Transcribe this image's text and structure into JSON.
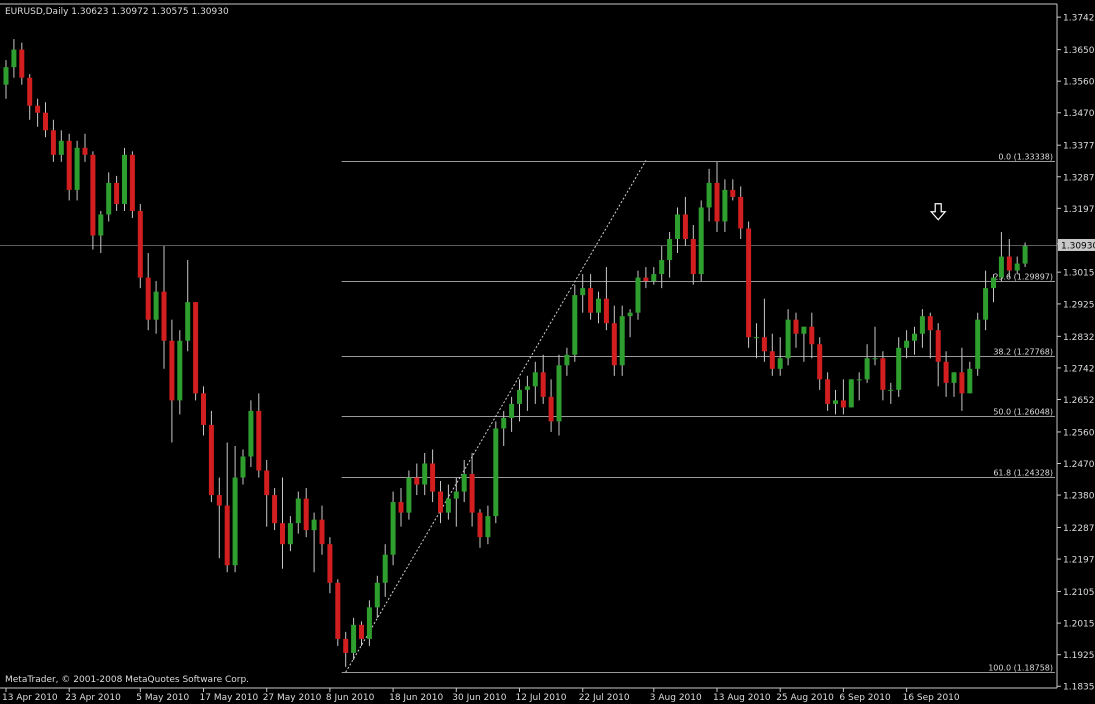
{
  "window": {
    "header": "EURUSD,Daily  1.30623 1.30972 1.30575 1.30930",
    "footer": "MetaTrader, © 2001-2008 MetaQuotes Software Corp."
  },
  "colors": {
    "background": "#000000",
    "frame": "#c8c8c8",
    "text": "#dcdcdc",
    "bull": "#2e9e2e",
    "bear": "#d21e1e",
    "wick": "#c8c8c8",
    "fib": "#9a9a9a",
    "price_tag_bg": "#c8c8c8",
    "price_tag_text": "#000000"
  },
  "chart_data": {
    "type": "candlestick",
    "symbol": "EURUSD",
    "timeframe": "Daily",
    "ohlc_header": {
      "open": 1.30623,
      "high": 1.30972,
      "low": 1.30575,
      "close": 1.3093
    },
    "current_price": 1.3093,
    "current_price_label": "1.30930",
    "ylim": [
      1.183,
      1.378
    ],
    "y_ticks": [
      "1.37425",
      "1.36500",
      "1.35600",
      "1.34700",
      "1.33775",
      "1.32875",
      "1.31975",
      "1.30965",
      "1.30155",
      "1.29250",
      "1.28325",
      "1.27425",
      "1.26525",
      "1.25600",
      "1.24700",
      "1.23800",
      "1.22875",
      "1.21975",
      "1.21050",
      "1.20150",
      "1.19250",
      "1.18350"
    ],
    "x_ticks": [
      {
        "label": "13 Apr 2010",
        "index": 0
      },
      {
        "label": "23 Apr 2010",
        "index": 8
      },
      {
        "label": "5 May 2010",
        "index": 17
      },
      {
        "label": "17 May 2010",
        "index": 25
      },
      {
        "label": "27 May 2010",
        "index": 33
      },
      {
        "label": "8 Jun 2010",
        "index": 41
      },
      {
        "label": "18 Jun 2010",
        "index": 49
      },
      {
        "label": "30 Jun 2010",
        "index": 57
      },
      {
        "label": "12 Jul 2010",
        "index": 65
      },
      {
        "label": "22 Jul 2010",
        "index": 73
      },
      {
        "label": "3 Aug 2010",
        "index": 82
      },
      {
        "label": "13 Aug 2010",
        "index": 90
      },
      {
        "label": "25 Aug 2010",
        "index": 98
      },
      {
        "label": "6 Sep 2010",
        "index": 106
      },
      {
        "label": "16 Sep 2010",
        "index": 114
      }
    ],
    "candles": [
      [
        1.355,
        1.362,
        1.351,
        1.36
      ],
      [
        1.36,
        1.368,
        1.357,
        1.365
      ],
      [
        1.365,
        1.367,
        1.355,
        1.357
      ],
      [
        1.357,
        1.358,
        1.345,
        1.349
      ],
      [
        1.349,
        1.351,
        1.343,
        1.347
      ],
      [
        1.347,
        1.35,
        1.34,
        1.342
      ],
      [
        1.342,
        1.345,
        1.333,
        1.335
      ],
      [
        1.335,
        1.342,
        1.333,
        1.339
      ],
      [
        1.339,
        1.341,
        1.322,
        1.325
      ],
      [
        1.325,
        1.339,
        1.322,
        1.337
      ],
      [
        1.337,
        1.341,
        1.333,
        1.335
      ],
      [
        1.335,
        1.336,
        1.308,
        1.312
      ],
      [
        1.312,
        1.319,
        1.307,
        1.318
      ],
      [
        1.318,
        1.33,
        1.316,
        1.327
      ],
      [
        1.327,
        1.329,
        1.319,
        1.321
      ],
      [
        1.321,
        1.337,
        1.319,
        1.335
      ],
      [
        1.335,
        1.336,
        1.317,
        1.319
      ],
      [
        1.319,
        1.321,
        1.297,
        1.3
      ],
      [
        1.3,
        1.307,
        1.285,
        1.288
      ],
      [
        1.288,
        1.299,
        1.284,
        1.296
      ],
      [
        1.296,
        1.309,
        1.274,
        1.282
      ],
      [
        1.282,
        1.288,
        1.253,
        1.265
      ],
      [
        1.265,
        1.285,
        1.261,
        1.282
      ],
      [
        1.282,
        1.305,
        1.279,
        1.293
      ],
      [
        1.293,
        1.293,
        1.265,
        1.267
      ],
      [
        1.267,
        1.269,
        1.255,
        1.258
      ],
      [
        1.258,
        1.262,
        1.236,
        1.238
      ],
      [
        1.238,
        1.243,
        1.22,
        1.235
      ],
      [
        1.235,
        1.253,
        1.216,
        1.218
      ],
      [
        1.218,
        1.252,
        1.216,
        1.243
      ],
      [
        1.243,
        1.251,
        1.241,
        1.249
      ],
      [
        1.249,
        1.265,
        1.246,
        1.262
      ],
      [
        1.262,
        1.267,
        1.243,
        1.245
      ],
      [
        1.245,
        1.248,
        1.229,
        1.238
      ],
      [
        1.238,
        1.24,
        1.228,
        1.23
      ],
      [
        1.23,
        1.243,
        1.217,
        1.224
      ],
      [
        1.224,
        1.232,
        1.222,
        1.23
      ],
      [
        1.23,
        1.239,
        1.227,
        1.237
      ],
      [
        1.237,
        1.24,
        1.226,
        1.228
      ],
      [
        1.228,
        1.233,
        1.216,
        1.231
      ],
      [
        1.231,
        1.235,
        1.221,
        1.224
      ],
      [
        1.224,
        1.226,
        1.21,
        1.213
      ],
      [
        1.213,
        1.214,
        1.195,
        1.197
      ],
      [
        1.197,
        1.199,
        1.189,
        1.193
      ],
      [
        1.193,
        1.203,
        1.191,
        1.201
      ],
      [
        1.201,
        1.202,
        1.195,
        1.197
      ],
      [
        1.197,
        1.208,
        1.195,
        1.206
      ],
      [
        1.206,
        1.215,
        1.203,
        1.213
      ],
      [
        1.213,
        1.224,
        1.209,
        1.221
      ],
      [
        1.221,
        1.239,
        1.218,
        1.236
      ],
      [
        1.236,
        1.24,
        1.229,
        1.233
      ],
      [
        1.233,
        1.245,
        1.231,
        1.243
      ],
      [
        1.243,
        1.247,
        1.238,
        1.241
      ],
      [
        1.241,
        1.25,
        1.238,
        1.247
      ],
      [
        1.247,
        1.251,
        1.236,
        1.239
      ],
      [
        1.239,
        1.242,
        1.23,
        1.233
      ],
      [
        1.233,
        1.241,
        1.231,
        1.237
      ],
      [
        1.237,
        1.243,
        1.229,
        1.239
      ],
      [
        1.239,
        1.248,
        1.236,
        1.244
      ],
      [
        1.244,
        1.25,
        1.229,
        1.233
      ],
      [
        1.233,
        1.234,
        1.223,
        1.226
      ],
      [
        1.226,
        1.235,
        1.224,
        1.232
      ],
      [
        1.232,
        1.259,
        1.23,
        1.257
      ],
      [
        1.257,
        1.262,
        1.252,
        1.26
      ],
      [
        1.26,
        1.266,
        1.256,
        1.264
      ],
      [
        1.264,
        1.271,
        1.259,
        1.268
      ],
      [
        1.268,
        1.272,
        1.262,
        1.269
      ],
      [
        1.269,
        1.276,
        1.264,
        1.273
      ],
      [
        1.273,
        1.278,
        1.264,
        1.266
      ],
      [
        1.266,
        1.271,
        1.256,
        1.259
      ],
      [
        1.259,
        1.278,
        1.255,
        1.275
      ],
      [
        1.275,
        1.28,
        1.272,
        1.278
      ],
      [
        1.278,
        1.298,
        1.276,
        1.295
      ],
      [
        1.295,
        1.301,
        1.29,
        1.297
      ],
      [
        1.297,
        1.301,
        1.288,
        1.29
      ],
      [
        1.29,
        1.296,
        1.287,
        1.294
      ],
      [
        1.294,
        1.303,
        1.285,
        1.287
      ],
      [
        1.287,
        1.292,
        1.272,
        1.275
      ],
      [
        1.275,
        1.292,
        1.272,
        1.289
      ],
      [
        1.289,
        1.291,
        1.283,
        1.29
      ],
      [
        1.29,
        1.302,
        1.288,
        1.3
      ],
      [
        1.3,
        1.303,
        1.297,
        1.299
      ],
      [
        1.299,
        1.303,
        1.298,
        1.301
      ],
      [
        1.301,
        1.309,
        1.297,
        1.305
      ],
      [
        1.305,
        1.313,
        1.3,
        1.311
      ],
      [
        1.311,
        1.32,
        1.307,
        1.318
      ],
      [
        1.318,
        1.323,
        1.309,
        1.311
      ],
      [
        1.311,
        1.315,
        1.298,
        1.301
      ],
      [
        1.301,
        1.322,
        1.299,
        1.32
      ],
      [
        1.32,
        1.331,
        1.316,
        1.327
      ],
      [
        1.327,
        1.333,
        1.313,
        1.316
      ],
      [
        1.316,
        1.328,
        1.313,
        1.325
      ],
      [
        1.325,
        1.328,
        1.322,
        1.323
      ],
      [
        1.323,
        1.326,
        1.311,
        1.314
      ],
      [
        1.314,
        1.316,
        1.28,
        1.283
      ],
      [
        1.283,
        1.287,
        1.277,
        1.283
      ],
      [
        1.283,
        1.294,
        1.276,
        1.279
      ],
      [
        1.279,
        1.284,
        1.272,
        1.274
      ],
      [
        1.274,
        1.283,
        1.272,
        1.277
      ],
      [
        1.277,
        1.291,
        1.275,
        1.288
      ],
      [
        1.288,
        1.29,
        1.28,
        1.284
      ],
      [
        1.284,
        1.286,
        1.276,
        1.286
      ],
      [
        1.286,
        1.29,
        1.277,
        1.281
      ],
      [
        1.281,
        1.283,
        1.268,
        1.271
      ],
      [
        1.271,
        1.273,
        1.262,
        1.264
      ],
      [
        1.264,
        1.268,
        1.261,
        1.265
      ],
      [
        1.265,
        1.271,
        1.261,
        1.263
      ],
      [
        1.263,
        1.271,
        1.263,
        1.271
      ],
      [
        1.271,
        1.273,
        1.265,
        1.271
      ],
      [
        1.271,
        1.281,
        1.27,
        1.277
      ],
      [
        1.277,
        1.286,
        1.275,
        1.277
      ],
      [
        1.277,
        1.279,
        1.265,
        1.268
      ],
      [
        1.268,
        1.27,
        1.264,
        1.268
      ],
      [
        1.268,
        1.283,
        1.266,
        1.28
      ],
      [
        1.28,
        1.285,
        1.277,
        1.282
      ],
      [
        1.282,
        1.286,
        1.278,
        1.284
      ],
      [
        1.284,
        1.291,
        1.28,
        1.289
      ],
      [
        1.289,
        1.29,
        1.277,
        1.285
      ],
      [
        1.285,
        1.287,
        1.269,
        1.276
      ],
      [
        1.276,
        1.279,
        1.266,
        1.27
      ],
      [
        1.27,
        1.273,
        1.266,
        1.273
      ],
      [
        1.273,
        1.28,
        1.262,
        1.267
      ],
      [
        1.267,
        1.276,
        1.267,
        1.274
      ],
      [
        1.274,
        1.29,
        1.272,
        1.288
      ],
      [
        1.288,
        1.302,
        1.285,
        1.297
      ],
      [
        1.297,
        1.301,
        1.293,
        1.3
      ],
      [
        1.3,
        1.313,
        1.299,
        1.306
      ],
      [
        1.306,
        1.311,
        1.3,
        1.302
      ],
      [
        1.302,
        1.306,
        1.301,
        1.304
      ],
      [
        1.304,
        1.31,
        1.303,
        1.309
      ]
    ],
    "fibonacci": {
      "start_index": 43,
      "end_index": 81,
      "levels": [
        {
          "label": "0.0 (1.33338)",
          "price": 1.33338
        },
        {
          "label": "23.6 (1.29897)",
          "price": 1.29897
        },
        {
          "label": "38.2 (1.27768)",
          "price": 1.27768
        },
        {
          "label": "50.0 (1.26048)",
          "price": 1.26048
        },
        {
          "label": "61.8 (1.24328)",
          "price": 1.24328
        },
        {
          "label": "100.0 (1.18758)",
          "price": 1.18758
        }
      ],
      "trend_line": [
        {
          "index": 43,
          "price": 1.1875
        },
        {
          "index": 81,
          "price": 1.3334
        }
      ]
    },
    "arrow_index": 118,
    "arrow_price": 1.3165
  }
}
